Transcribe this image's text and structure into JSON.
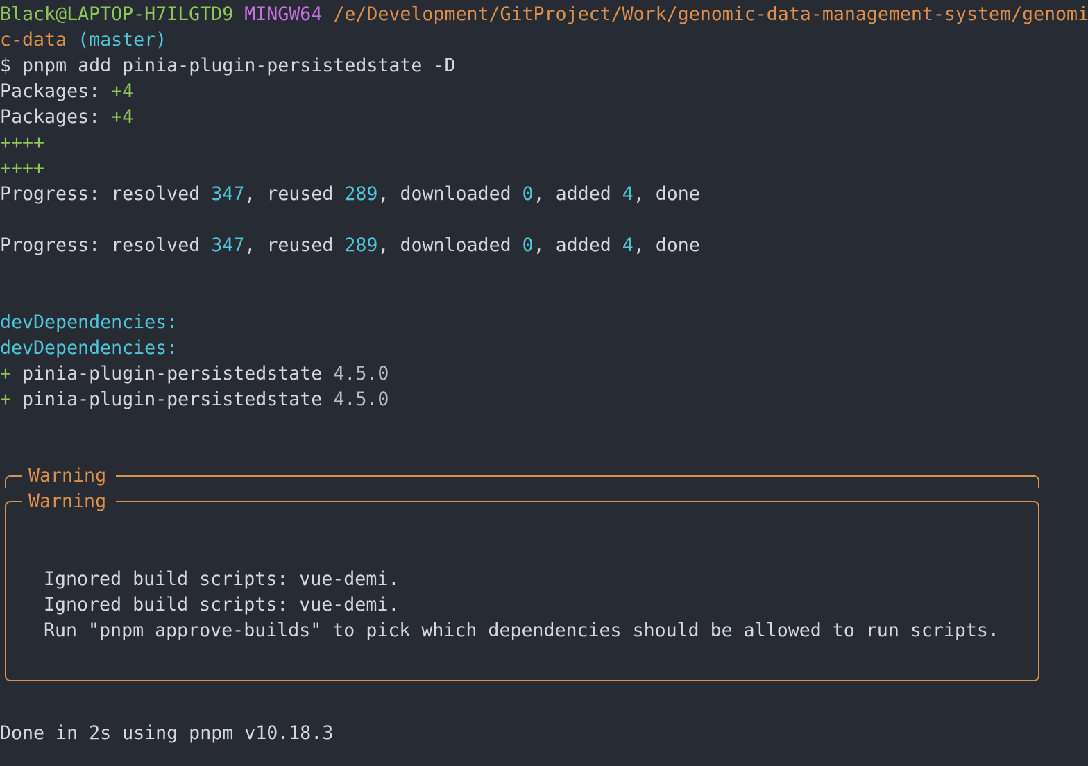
{
  "prompt": {
    "user_host": "Black@LAPTOP-H7ILGTD9",
    "shell": "MINGW64",
    "path_part1": "/e/Development/GitProject/Work/genomic-data-management-system/genomi",
    "path_part2": "c-data",
    "branch": "(master)",
    "symbol": "$",
    "command": "pnpm add pinia-plugin-persistedstate -D"
  },
  "packages": {
    "label": "Packages:",
    "count": "+4",
    "plus_bar": "++++"
  },
  "progress": {
    "label": "Progress:",
    "resolved_label": "resolved",
    "resolved": "347",
    "reused_label": "reused",
    "reused": "289",
    "downloaded_label": "downloaded",
    "downloaded": "0",
    "added_label": "added",
    "added": "4",
    "status": "done"
  },
  "dev_dependencies": {
    "header": "devDependencies:",
    "plus": "+",
    "package_name": "pinia-plugin-persistedstate",
    "version": "4.5.0"
  },
  "warning": {
    "title": "Warning",
    "ignored": "Ignored build scripts: vue-demi.",
    "run_hint": "Run \"pnpm approve-builds\" to pick which dependencies should be allowed to run scripts."
  },
  "done": {
    "text": "Done in 2s using pnpm v10.18.3"
  },
  "colors": {
    "background": "#272b34",
    "foreground": "#d4d7de",
    "green": "#8dc556",
    "purple": "#c86ee3",
    "orange": "#de8f4a",
    "cyan": "#4fc6d8"
  }
}
